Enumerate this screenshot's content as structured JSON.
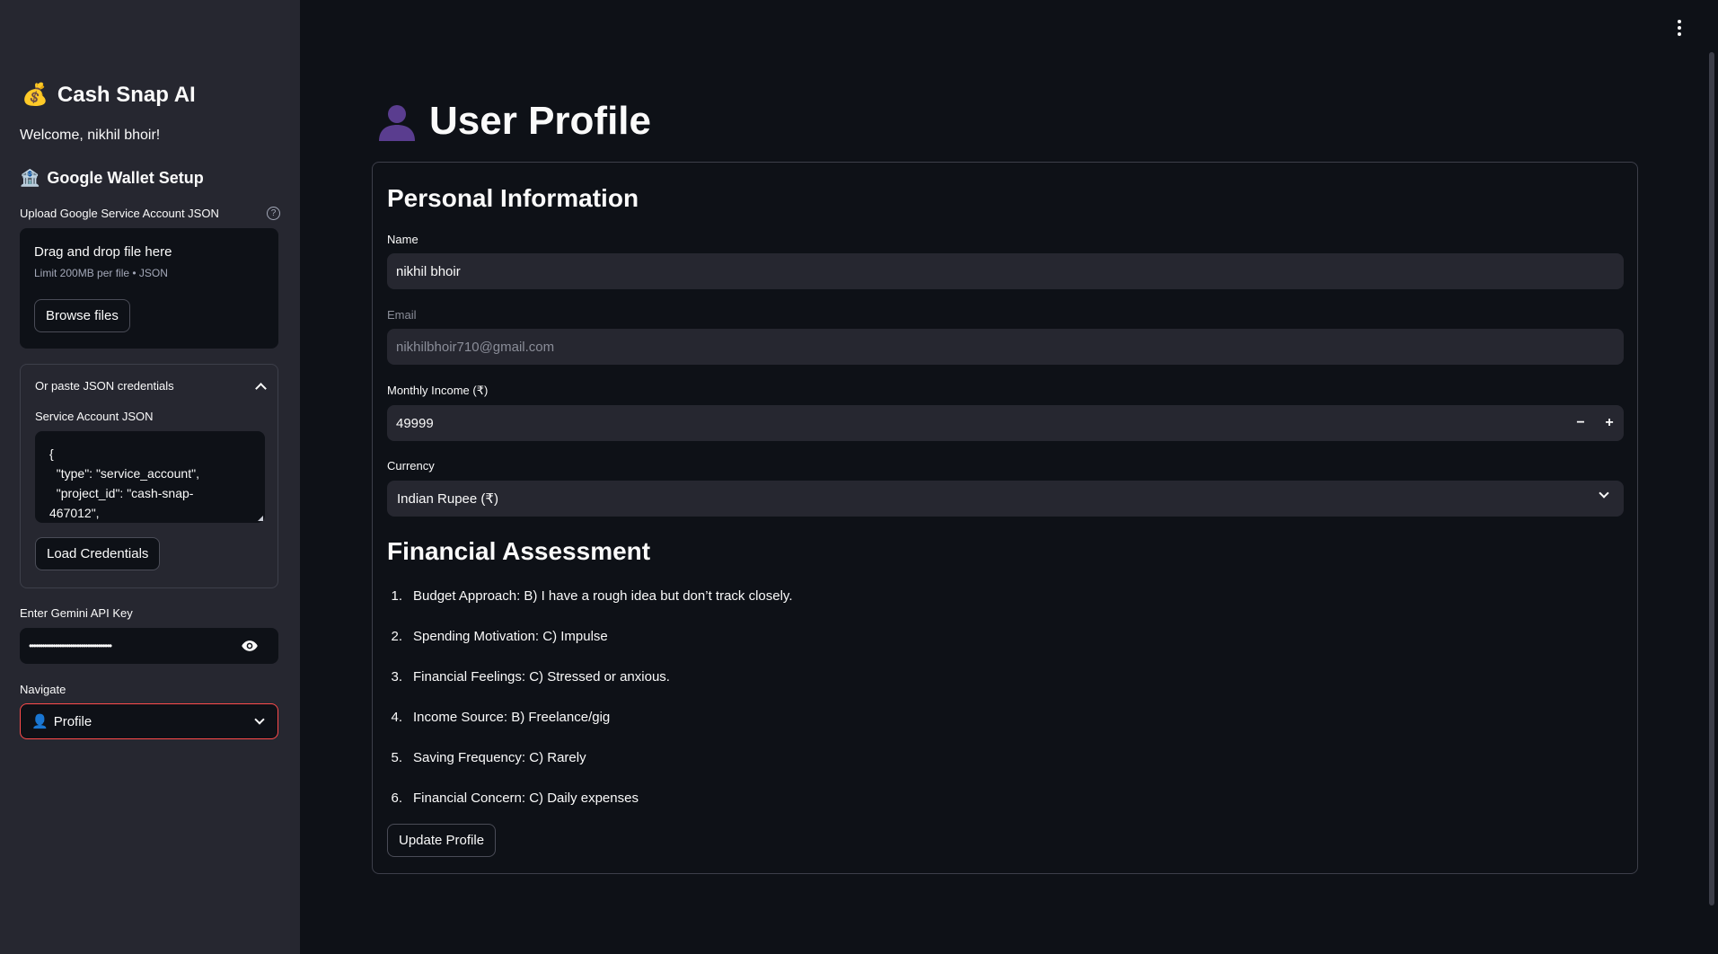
{
  "sidebar": {
    "title_emoji": "💰",
    "title": "Cash Snap AI",
    "welcome": "Welcome, nikhil bhoir!",
    "wallet_emoji": "🏦",
    "wallet_heading": "Google Wallet Setup",
    "upload_label": "Upload Google Service Account JSON",
    "help_icon": "?",
    "dropzone_title": "Drag and drop file here",
    "dropzone_limit": "Limit 200MB per file • JSON",
    "browse_button": "Browse files",
    "expander_label": "Or paste JSON credentials",
    "service_account_label": "Service Account JSON",
    "service_account_value": "{\n  \"type\": \"service_account\",\n  \"project_id\": \"cash-snap-\n467012\",",
    "load_button": "Load Credentials",
    "gemini_label": "Enter Gemini API Key",
    "gemini_value": "••••••••••••••••••••••••••••••••••••••",
    "navigate_label": "Navigate",
    "navigate_emoji": "👤",
    "navigate_value": "Profile"
  },
  "main": {
    "title_emoji": "👤",
    "title": "User Profile",
    "personal_heading": "Personal Information",
    "name_label": "Name",
    "name_value": "nikhil bhoir",
    "email_label": "Email",
    "email_value": "nikhilbhoir710@gmail.com",
    "income_label": "Monthly Income (₹)",
    "income_value": "49999",
    "minus": "−",
    "plus": "+",
    "currency_label": "Currency",
    "currency_value": "Indian Rupee (₹)",
    "assessment_heading": "Financial Assessment",
    "assessment": [
      {
        "num": "1.",
        "text": "Budget Approach: B) I have a rough idea but don’t track closely."
      },
      {
        "num": "2.",
        "text": "Spending Motivation: C) Impulse"
      },
      {
        "num": "3.",
        "text": "Financial Feelings: C) Stressed or anxious."
      },
      {
        "num": "4.",
        "text": "Income Source: B) Freelance/gig"
      },
      {
        "num": "5.",
        "text": "Saving Frequency: C) Rarely"
      },
      {
        "num": "6.",
        "text": "Financial Concern: C) Daily expenses"
      }
    ],
    "update_button": "Update Profile"
  }
}
